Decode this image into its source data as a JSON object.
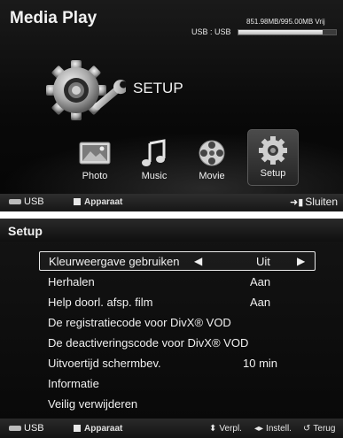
{
  "media_play": {
    "title": "Media Play",
    "usb_label": "USB : USB",
    "storage_text": "851.98MB/995.00MB Vrij",
    "storage_used_fraction": 0.86,
    "section_title": "SETUP",
    "items": [
      {
        "label": "Photo",
        "icon": "photo-icon"
      },
      {
        "label": "Music",
        "icon": "music-note-icon"
      },
      {
        "label": "Movie",
        "icon": "film-reel-icon"
      },
      {
        "label": "Setup",
        "icon": "gear-icon",
        "selected": true
      }
    ],
    "status": {
      "usb": "USB",
      "device": "Apparaat",
      "close": "Sluiten"
    }
  },
  "setup": {
    "title": "Setup",
    "rows": [
      {
        "label": "Kleurweergave gebruiken",
        "value": "Uit",
        "selected": true
      },
      {
        "label": "Herhalen",
        "value": "Aan"
      },
      {
        "label": "Help doorl. afsp. film",
        "value": "Aan"
      },
      {
        "label": "De registratiecode voor DivX® VOD",
        "value": ""
      },
      {
        "label": "De deactiveringscode voor DivX® VOD",
        "value": ""
      },
      {
        "label": "Uitvoertijd schermbev.",
        "value": "10 min"
      },
      {
        "label": "Informatie",
        "value": ""
      },
      {
        "label": "Veilig verwijderen",
        "value": ""
      }
    ],
    "status": {
      "usb": "USB",
      "device": "Apparaat",
      "hint_move": "Verpl.",
      "hint_set": "Instell.",
      "hint_back": "Terug"
    }
  },
  "colors": {
    "panel_bg": "#0a0a0a",
    "text": "#f0f0f0",
    "highlight_border": "#eaeaea"
  }
}
